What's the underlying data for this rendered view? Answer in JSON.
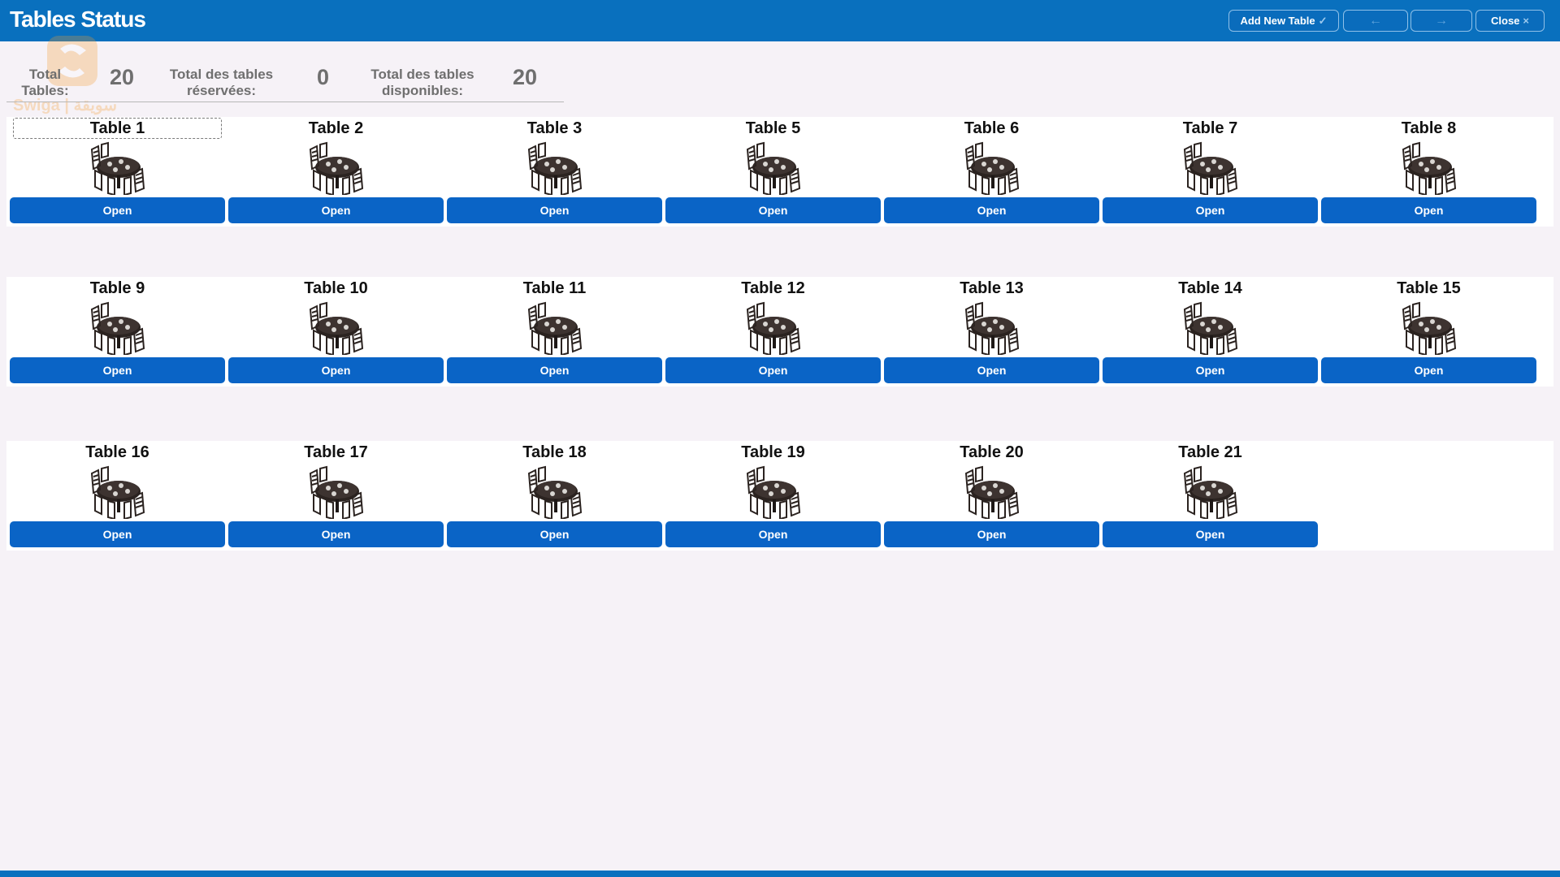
{
  "header": {
    "title": "Tables Status",
    "buttons": {
      "add_new_table": "Add New Table",
      "add_icon": "check-icon",
      "back_icon": "arrow-left-icon",
      "forward_icon": "arrow-right-icon",
      "close": "Close",
      "close_icon": "close-x-icon"
    }
  },
  "watermark": {
    "text": "Swiga | سويقة",
    "logo": "swiga-logo"
  },
  "stats": {
    "total_label": "Total Tables:",
    "total_value": "20",
    "reserved_label": "Total des tables réservées:",
    "reserved_value": "0",
    "available_label": "Total des tables disponibles:",
    "available_value": "20"
  },
  "open_label": "Open",
  "tables": [
    "Table 1",
    "Table 2",
    "Table 3",
    "Table 5",
    "Table 6",
    "Table 7",
    "Table 8",
    "Table 9",
    "Table 10",
    "Table 11",
    "Table 12",
    "Table 13",
    "Table 14",
    "Table 15",
    "Table 16",
    "Table 17",
    "Table 18",
    "Table 19",
    "Table 20",
    "Table 21"
  ],
  "table_icon": "dining-table-icon",
  "colors": {
    "header_bg": "#0970be",
    "button_blue": "#0a64c6",
    "page_bg": "#f6f2f7"
  }
}
